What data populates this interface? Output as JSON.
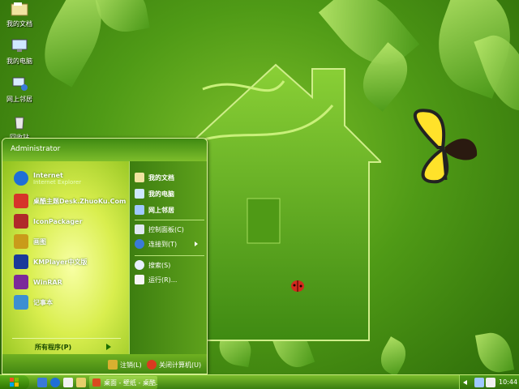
{
  "desktop": {
    "icons": [
      {
        "label": "我的文档",
        "icon": "folder-documents-icon"
      },
      {
        "label": "我的电脑",
        "icon": "my-computer-icon"
      },
      {
        "label": "网上邻居",
        "icon": "network-places-icon"
      },
      {
        "label": "回收站",
        "icon": "recycle-bin-icon"
      }
    ]
  },
  "start_menu": {
    "user": "Administrator",
    "programs": [
      {
        "label": "Internet",
        "sub": "Internet Explorer",
        "icon": "internet-explorer-icon",
        "color": "#1e6fd6"
      },
      {
        "label": "桌酷主题Desk.ZhuoKu.Com",
        "icon": "zhuoku-icon",
        "color": "#d6342a"
      },
      {
        "label": "IconPackager",
        "icon": "iconpackager-icon",
        "color": "#b02a2a"
      },
      {
        "label": "画图",
        "icon": "paint-icon",
        "color": "#c99b1a"
      },
      {
        "label": "KMPlayer中文版",
        "icon": "kmplayer-icon",
        "color": "#1a3a9a"
      },
      {
        "label": "WinRAR",
        "icon": "winrar-icon",
        "color": "#7b2a9a"
      },
      {
        "label": "记事本",
        "icon": "notepad-icon",
        "color": "#3d8fd1"
      }
    ],
    "all_programs": "所有程序(P)",
    "places": [
      {
        "label": "我的文档",
        "icon": "my-documents-icon"
      },
      {
        "label": "我的电脑",
        "icon": "my-computer-icon"
      },
      {
        "label": "网上邻居",
        "icon": "network-places-icon"
      }
    ],
    "system": [
      {
        "label": "控制面板(C)",
        "icon": "control-panel-icon"
      },
      {
        "label": "连接到(T)",
        "icon": "connect-to-icon"
      }
    ],
    "tools": [
      {
        "label": "搜索(S)",
        "icon": "search-icon"
      },
      {
        "label": "运行(R)...",
        "icon": "run-icon"
      }
    ],
    "logoff": "注销(L)",
    "shutdown": "关闭计算机(U)"
  },
  "taskbar": {
    "task_label": "桌面 - 壁纸 - 桌酷...",
    "clock": "10:44"
  },
  "colors": {
    "wallpaper_green": "#4f9a16",
    "menu_yellow": "#d9ee4e"
  }
}
